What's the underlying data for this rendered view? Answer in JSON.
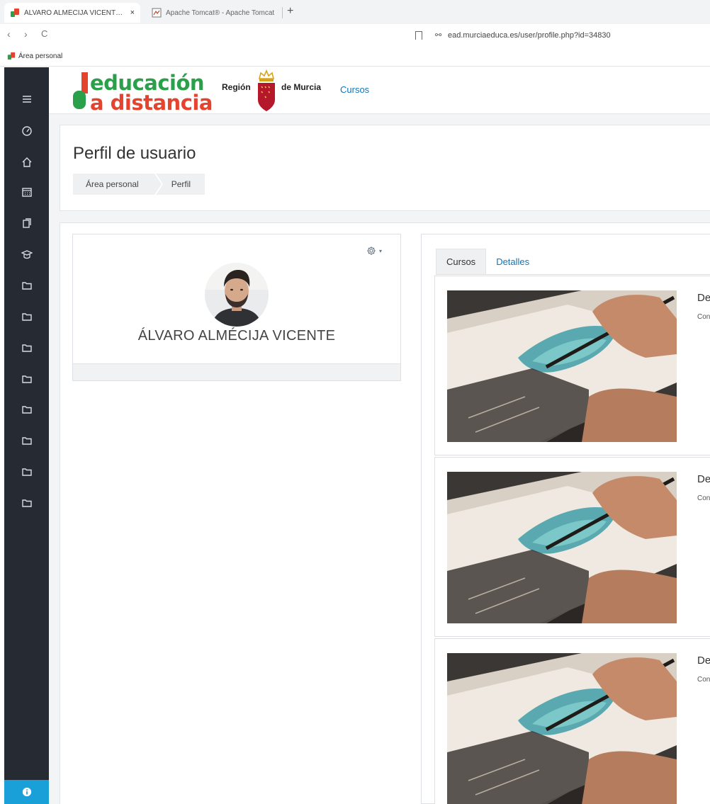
{
  "browser": {
    "tabs": [
      {
        "title": "ÁLVARO ALMÉCIJA VICENTE: Pe",
        "active": true,
        "close": "×"
      },
      {
        "title": "Apache Tomcat® - Apache Tomcat",
        "active": false
      }
    ],
    "new_tab": "+",
    "nav": {
      "back": "‹",
      "forward": "›",
      "reload": "C"
    },
    "url": "ead.murciaeduca.es/user/profile.php?id=34830",
    "site_icon": "⚯",
    "bookmarks": [
      {
        "label": "Área personal"
      }
    ]
  },
  "header": {
    "logo_line1": "educación",
    "logo_line2": "a distancia",
    "region_left": "Región",
    "region_right": "de Murcia",
    "nav_link": "Cursos"
  },
  "sidebar": {
    "icons": [
      "menu-icon",
      "dashboard-icon",
      "home-icon",
      "calendar-icon",
      "files-icon",
      "graduation-cap-icon",
      "folder-icon",
      "folder-icon",
      "folder-icon",
      "folder-icon",
      "folder-icon",
      "folder-icon",
      "folder-icon",
      "folder-icon"
    ],
    "bottom_icon": "info-icon"
  },
  "page": {
    "title": "Perfil de usuario",
    "breadcrumb": [
      "Área personal",
      "Perfil"
    ]
  },
  "profile": {
    "name": "ÁLVARO ALMÉCIJA VICENTE",
    "menu_caret": "▾"
  },
  "courses_panel": {
    "tabs": [
      {
        "label": "Cursos",
        "active": true
      },
      {
        "label": "Detalles",
        "active": false
      }
    ],
    "courses": [
      {
        "title": "De",
        "subtitle": "Con"
      },
      {
        "title": "De",
        "subtitle": "Con"
      },
      {
        "title": "De",
        "subtitle": "Con"
      }
    ]
  },
  "colors": {
    "sidebar_bg": "#262b33",
    "accent_link": "#1175b8",
    "logo_green": "#2aa04a",
    "logo_red": "#e6432f",
    "info_button": "#1aa0d9"
  }
}
